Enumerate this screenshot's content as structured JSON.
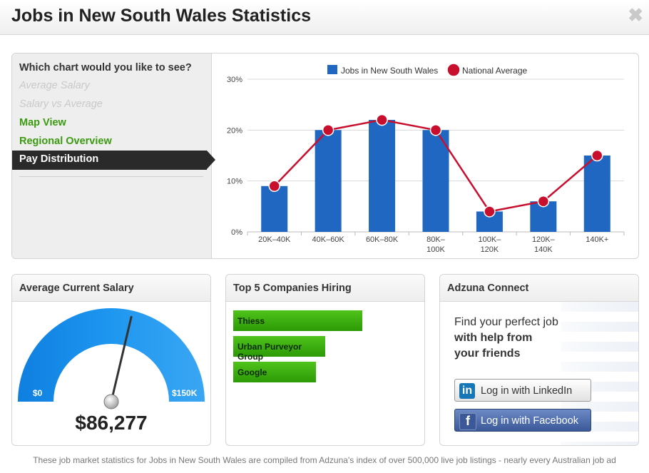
{
  "header": {
    "title": "Jobs in New South Wales Statistics"
  },
  "menu": {
    "question": "Which chart would you like to see?",
    "items": [
      {
        "label": "Average Salary",
        "state": "disabled"
      },
      {
        "label": "Salary vs Average",
        "state": "disabled"
      },
      {
        "label": "Map View",
        "state": "link"
      },
      {
        "label": "Regional Overview",
        "state": "link"
      },
      {
        "label": "Pay Distribution",
        "state": "active"
      }
    ]
  },
  "chart_data": {
    "type": "bar",
    "categories": [
      "20K–40K",
      "40K–60K",
      "60K–80K",
      "80K–100K",
      "100K–120K",
      "120K–140K",
      "140K+"
    ],
    "category_lines": [
      [
        "20K–40K"
      ],
      [
        "40K–60K"
      ],
      [
        "60K–80K"
      ],
      [
        "80K–",
        "100K"
      ],
      [
        "100K–",
        "120K"
      ],
      [
        "120K–",
        "140K"
      ],
      [
        "140K+"
      ]
    ],
    "series": [
      {
        "name": "Jobs in New South Wales",
        "type": "bar",
        "color": "#1f67c0",
        "values": [
          9,
          20,
          22,
          20,
          4,
          6,
          15
        ]
      },
      {
        "name": "National Average",
        "type": "line",
        "color": "#c8102e",
        "values": [
          9,
          20,
          22,
          20,
          4,
          6,
          15
        ]
      }
    ],
    "ylim": [
      0,
      30
    ],
    "yticks": [
      "0%",
      "10%",
      "20%",
      "30%"
    ],
    "ytick_values": [
      0,
      10,
      20,
      30
    ],
    "grid": true,
    "legend": "top-center"
  },
  "salary": {
    "title": "Average Current Salary",
    "min_label": "$0",
    "max_label": "$150K",
    "value": "$86,277",
    "gauge_fraction": 0.574
  },
  "companies": {
    "title": "Top 5 Companies Hiring",
    "items": [
      {
        "name": "Thiess",
        "share": 1.0
      },
      {
        "name": "Urban Purveyor Group",
        "share": 0.71
      },
      {
        "name": "Google",
        "share": 0.64
      }
    ]
  },
  "connect": {
    "title": "Adzuna Connect",
    "line1": "Find your perfect job",
    "line2": "with help from",
    "line3": "your friends",
    "linkedin_label": "Log in with LinkedIn",
    "facebook_label": "Log in with Facebook",
    "linkedin_icon": "in",
    "facebook_icon": "f"
  },
  "footer": {
    "text": "These job market statistics for Jobs in New South Wales are compiled from Adzuna's index of over 500,000 live job listings - nearly every Australian job ad"
  }
}
